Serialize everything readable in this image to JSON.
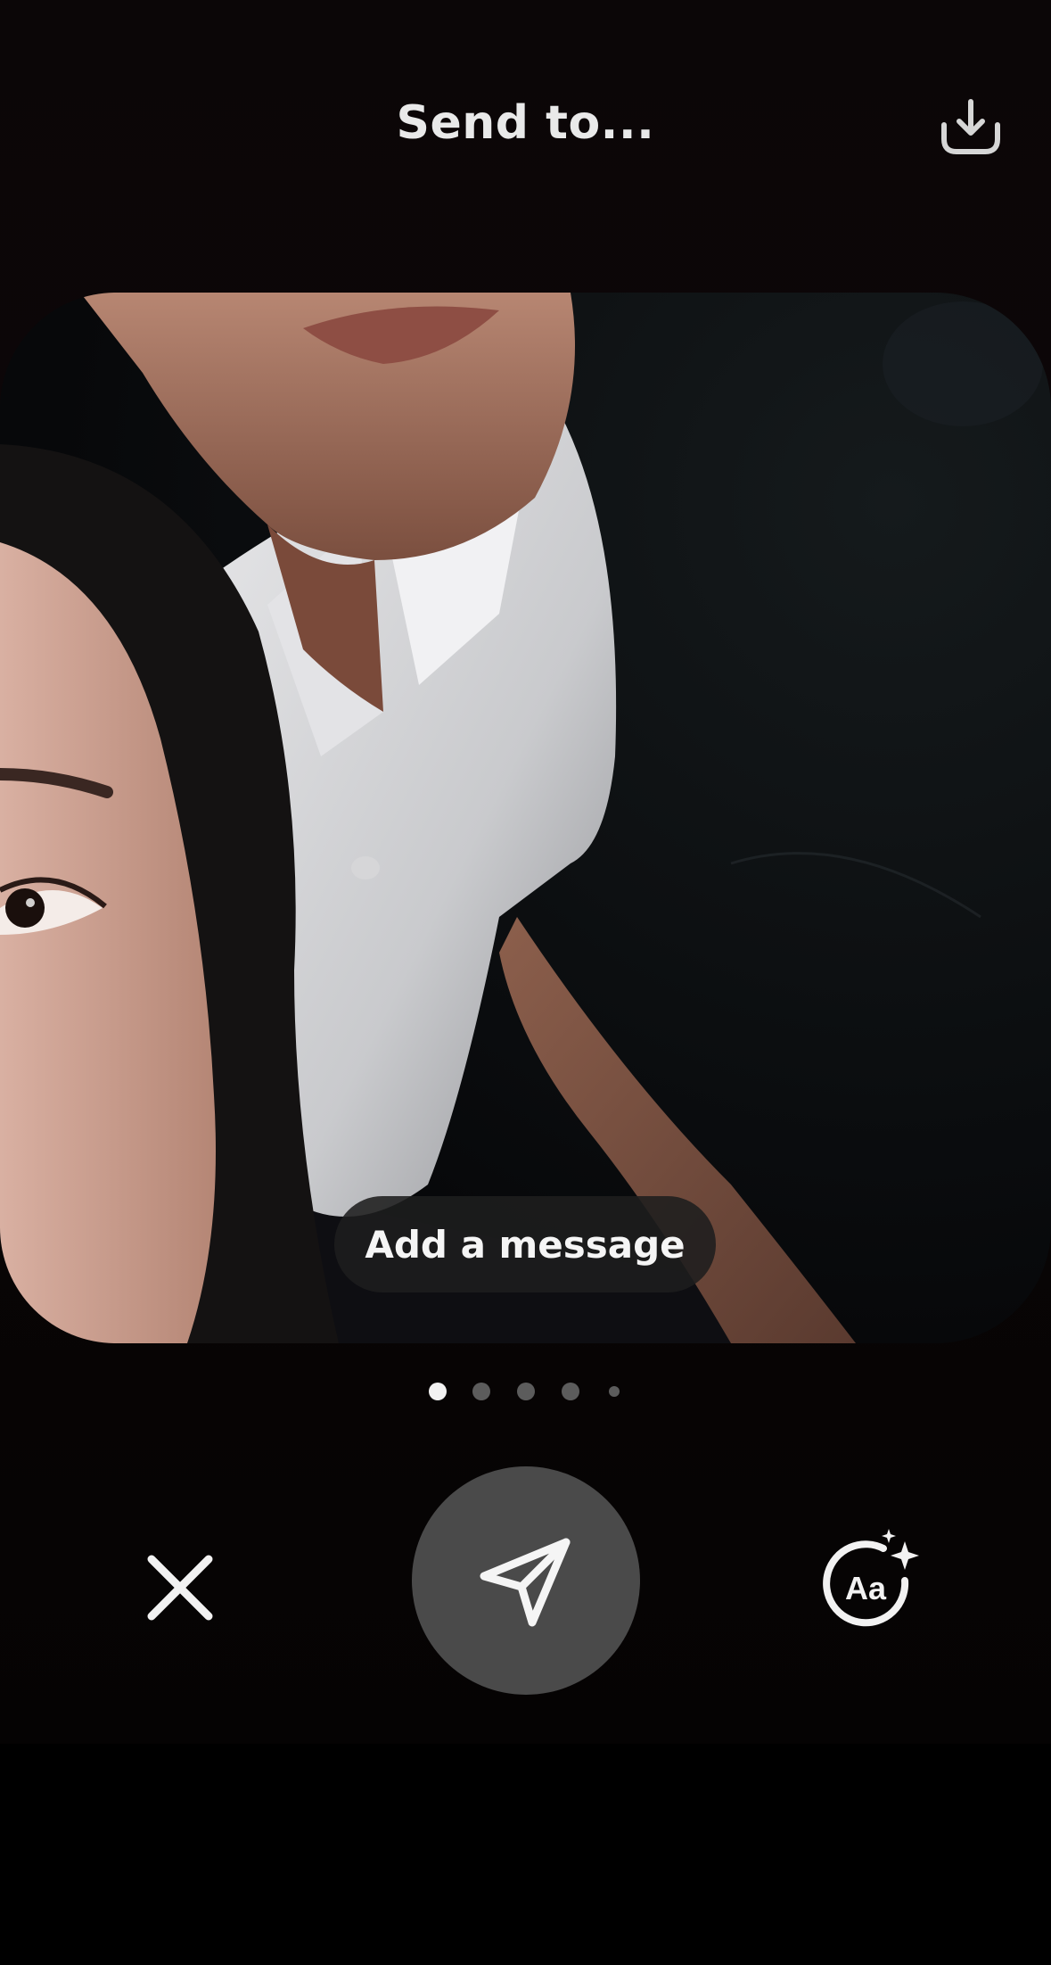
{
  "header": {
    "title": "Send to..."
  },
  "icons": {
    "download": "download-icon",
    "close": "close-icon",
    "send": "paper-plane-icon",
    "text_style": "text-style-sparkle-icon"
  },
  "photo": {
    "caption_button": "Add a message"
  },
  "pager": {
    "count": 5,
    "active_index": 0
  },
  "colors": {
    "background": "#0b0607",
    "send_button": "#4a4a4a",
    "active_dot": "#f2f2f2",
    "inactive_dot": "#5c5c5c"
  }
}
